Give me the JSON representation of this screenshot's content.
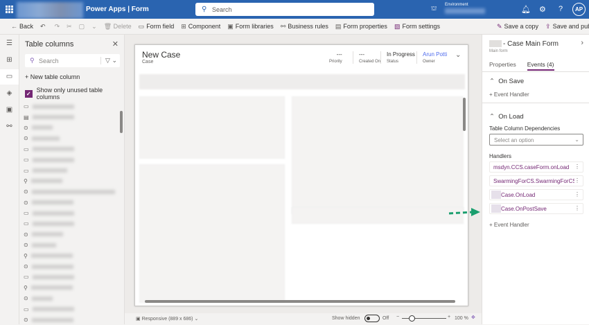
{
  "header": {
    "app": "Power Apps",
    "separator": "|",
    "section": "Form",
    "search_placeholder": "Search",
    "environment_label": "Environment",
    "avatar": "AP"
  },
  "toolbar": {
    "back": "Back",
    "delete": "Delete",
    "form_field": "Form field",
    "component": "Component",
    "form_libraries": "Form libraries",
    "business_rules": "Business rules",
    "form_properties": "Form properties",
    "form_settings": "Form settings",
    "save_copy": "Save a copy",
    "save_publish": "Save and publish"
  },
  "table_columns": {
    "title": "Table columns",
    "search_placeholder": "Search",
    "new_column": "New table column",
    "show_unused": "Show only unused table columns"
  },
  "form": {
    "title": "New Case",
    "entity": "Case",
    "fields": [
      {
        "value": "---",
        "label": "Priority"
      },
      {
        "value": "---",
        "label": "Created On"
      },
      {
        "value": "In Progress",
        "label": "Status"
      },
      {
        "value": "Arun Potti",
        "label": "Owner"
      }
    ]
  },
  "status_bar": {
    "responsive": "Responsive (889 x 686)",
    "show_hidden": "Show hidden",
    "toggle_state": "Off",
    "zoom": "100 %"
  },
  "right_panel": {
    "title": "- Case Main Form",
    "subtitle": "Main form",
    "tabs": [
      "Properties",
      "Events (4)"
    ],
    "on_save": "On Save",
    "event_handler": "Event Handler",
    "on_load": "On Load",
    "dependencies_label": "Table Column Dependencies",
    "dependencies_placeholder": "Select an option",
    "handlers_label": "Handlers",
    "handlers": [
      "msdyn.CCS.caseForm.onLoad",
      "SwarmingForCS.SwarmingForCS",
      "Case.OnLoad",
      "Case.OnPostSave"
    ]
  },
  "colors": {
    "header": "#2a64b0",
    "accent": "#742774",
    "arrow": "#1a9e6e"
  }
}
